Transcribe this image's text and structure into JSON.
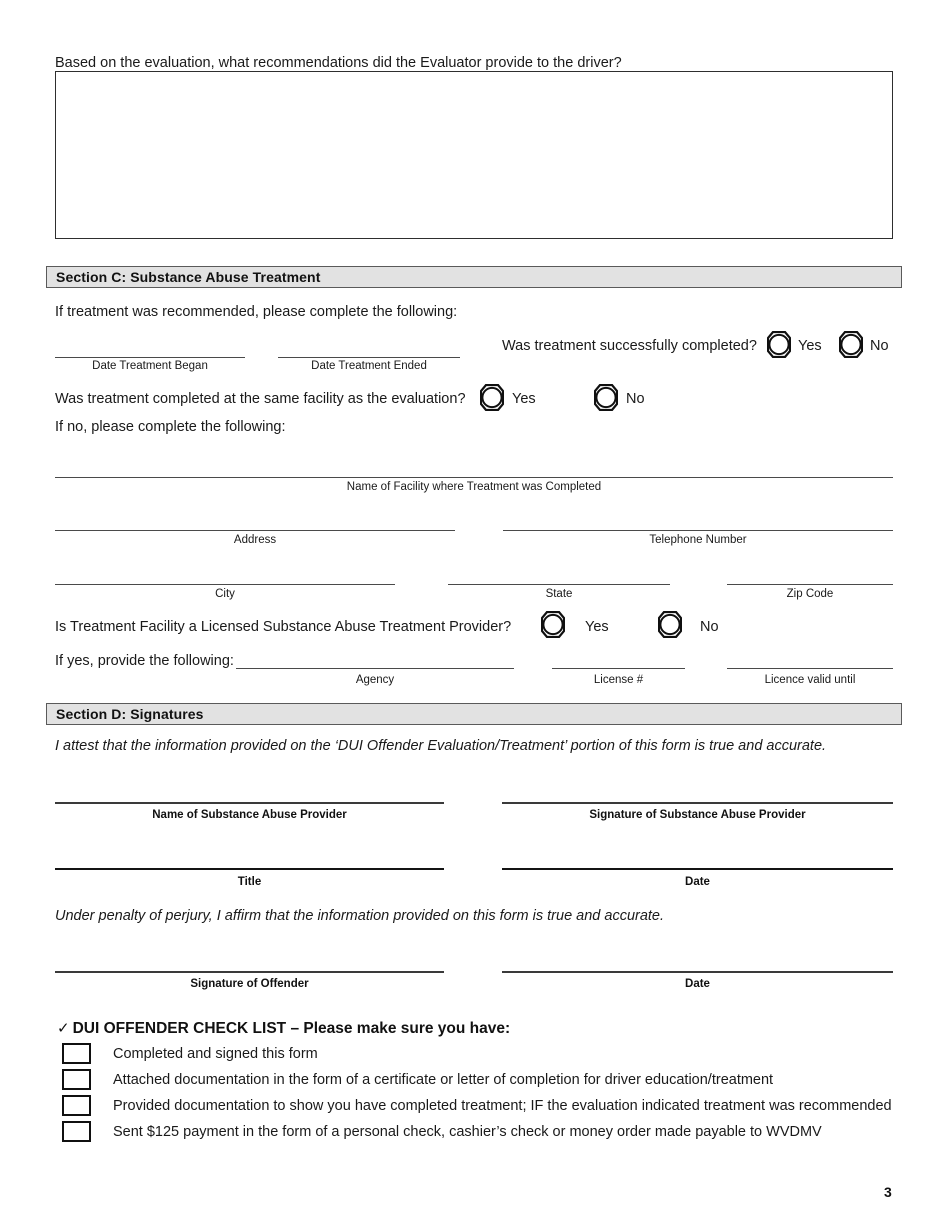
{
  "document": {
    "page_number": "3",
    "top_question": "Based on the evaluation, what recommendations did the Evaluator provide to the driver?",
    "answer_box_value": ""
  },
  "section_c": {
    "heading": "Section C: Substance Abuse Treatment",
    "intro": "If treatment was recommended, please complete the following:",
    "date_began_caption": "Date Treatment Began",
    "date_began_value": "",
    "date_ended_caption": "Date Treatment Ended",
    "date_ended_value": "",
    "q_successfully_completed": "Was treatment successfully completed?",
    "q_successfully_completed_yes": "Yes",
    "q_successfully_completed_no": "No",
    "q_same_facility": "Was treatment completed at the same facility as the evaluation?",
    "q_same_facility_yes": "Yes",
    "q_same_facility_no": "No",
    "if_no_text": "If no, please complete the following:",
    "facility_caption": "Name of Facility where Treatment was Completed",
    "facility_value": "",
    "address_caption": "Address",
    "address_value": "",
    "telephone_caption": "Telephone Number",
    "telephone_value": "",
    "city_caption": "City",
    "city_value": "",
    "state_caption": "State",
    "state_value": "",
    "zip_caption": "Zip Code",
    "zip_value": "",
    "q_licensed_provider": "Is Treatment Facility a Licensed Substance Abuse Treatment Provider?",
    "q_licensed_provider_yes": "Yes",
    "q_licensed_provider_no": "No",
    "if_yes_text": "If yes, provide the following:",
    "agency_caption": "Agency",
    "agency_value": "",
    "license_caption": "License #",
    "license_value": "",
    "license_valid_caption": "Licence valid until",
    "license_valid_value": ""
  },
  "section_d": {
    "heading": "Section D: Signatures",
    "attest_text": "I attest that the information provided on the ‘DUI Offender Evaluation/Treatment’ portion of this form is true and accurate.",
    "provider_name_caption": "Name of Substance Abuse Provider",
    "provider_name_value": "",
    "provider_signature_caption": "Signature of Substance Abuse Provider",
    "provider_signature_value": "",
    "title_caption": "Title",
    "title_value": "",
    "provider_date_caption": "Date",
    "provider_date_value": "",
    "perjury_text": "Under penalty of perjury, I affirm that the information provided on this form is true and accurate.",
    "offender_signature_caption": "Signature of Offender",
    "offender_signature_value": "",
    "offender_date_caption": "Date",
    "offender_date_value": ""
  },
  "checklist": {
    "check_glyph": "✓",
    "heading": "DUI OFFENDER CHECK LIST – Please make sure you have:",
    "items": [
      {
        "label": "Completed and signed this form",
        "checked": false
      },
      {
        "label": "Attached documentation in the form of a certificate or letter of completion for  driver education/treatment",
        "checked": false
      },
      {
        "label": "Provided documentation to show you have completed treatment; IF the evaluation indicated treatment was recommended",
        "checked": false
      },
      {
        "label": "Sent $125 payment in the form of a personal check, cashier’s check or money order made payable to WVDMV",
        "checked": false
      }
    ]
  },
  "colors": {
    "section_bar_bg": "#e2e2e2",
    "section_bar_border": "#5a5a5a",
    "rule": "#4a4a4a",
    "text": "#1a1a1a"
  }
}
